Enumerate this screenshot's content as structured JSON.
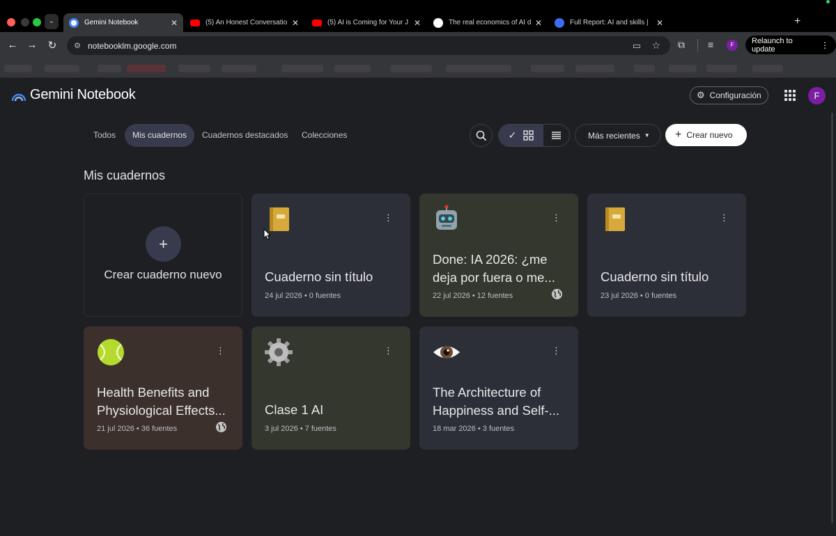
{
  "browser": {
    "tabs": [
      {
        "title": "Gemini Notebook",
        "favicon": "notebook-icon",
        "active": true
      },
      {
        "title": "(5) An Honest Conversatio",
        "favicon": "youtube-icon"
      },
      {
        "title": "(5) AI is Coming for Your J",
        "favicon": "youtube-icon"
      },
      {
        "title": "The real economics of AI d",
        "favicon": "site-icon"
      },
      {
        "title": "Full Report: AI and skills |",
        "favicon": "report-icon"
      }
    ],
    "url": "notebooklm.google.com",
    "profile_initial": "F",
    "relaunch_label": "Relaunch to update"
  },
  "app": {
    "brand": "Gemini Notebook",
    "settings_label": "Configuración",
    "avatar_initial": "F"
  },
  "filters": {
    "items": [
      "Todos",
      "Mis cuadernos",
      "Cuadernos destacados",
      "Colecciones"
    ],
    "active": "Mis cuadernos"
  },
  "controls": {
    "sort_label": "Más recientes",
    "create_label": "Crear nuevo"
  },
  "section_title": "Mis cuadernos",
  "create_card_label": "Crear cuaderno nuevo",
  "notebooks": [
    {
      "title": "Cuaderno sin título",
      "date": "24 jul 2026",
      "sources": "0 fuentes",
      "meta": "24 jul 2026 • 0 fuentes",
      "icon": "notebook-emoji",
      "color": "#2c2f38",
      "shared": false
    },
    {
      "title": "Done: IA 2026: ¿me deja por fuera o me...",
      "date": "22 jul 2026",
      "sources": "12 fuentes",
      "meta": "22 jul 2026 • 12 fuentes",
      "icon": "robot-emoji",
      "color": "#33372d",
      "shared": true
    },
    {
      "title": "Cuaderno sin título",
      "date": "23 jul 2026",
      "sources": "0 fuentes",
      "meta": "23 jul 2026 • 0 fuentes",
      "icon": "notebook-emoji",
      "color": "#2c2f38",
      "shared": false
    },
    {
      "title": "Health Benefits and Physiological Effects...",
      "date": "21 jul 2026",
      "sources": "36 fuentes",
      "meta": "21 jul 2026 • 36 fuentes",
      "icon": "tennis-ball-emoji",
      "color": "#3b302c",
      "shared": true
    },
    {
      "title": "Clase 1 AI",
      "date": "3 jul 2026",
      "sources": "7 fuentes",
      "meta": "3 jul 2026 • 7 fuentes",
      "icon": "gear-emoji",
      "color": "#33372d",
      "shared": false
    },
    {
      "title": "The Architecture of Happiness and Self-...",
      "date": "18 mar 2026",
      "sources": "3 fuentes",
      "meta": "18 mar 2026 • 3 fuentes",
      "icon": "eye-emoji",
      "color": "#2c2f38",
      "shared": false
    }
  ]
}
